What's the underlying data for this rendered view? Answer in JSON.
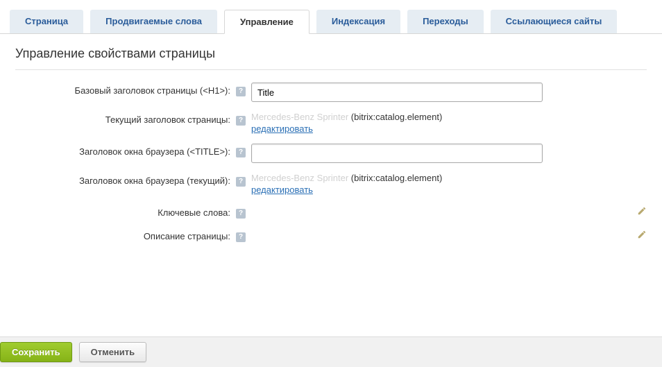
{
  "tabs": {
    "page": "Страница",
    "keywords": "Продвигаемые слова",
    "manage": "Управление",
    "index": "Индексация",
    "visits": "Переходы",
    "refs": "Ссылающиеся сайты"
  },
  "title": "Управление свойствами страницы",
  "form": {
    "h1": {
      "label": "Базовый заголовок страницы (<H1>):",
      "value": "Title"
    },
    "current_title": {
      "label": "Текущий заголовок страницы:",
      "dimmed": "Mercedes-Benz Sprinter",
      "suffix": " (bitrix:catalog.element)",
      "edit": "редактировать"
    },
    "browser_title": {
      "label": "Заголовок окна браузера (<TITLE>):",
      "value": ""
    },
    "browser_title_current": {
      "label": "Заголовок окна браузера (текущий):",
      "dimmed": "Mercedes-Benz Sprinter",
      "suffix": " (bitrix:catalog.element)",
      "edit": "редактировать"
    },
    "keywords": {
      "label": "Ключевые слова:"
    },
    "description": {
      "label": "Описание страницы:"
    }
  },
  "buttons": {
    "save": "Сохранить",
    "cancel": "Отменить"
  },
  "help_glyph": "?"
}
